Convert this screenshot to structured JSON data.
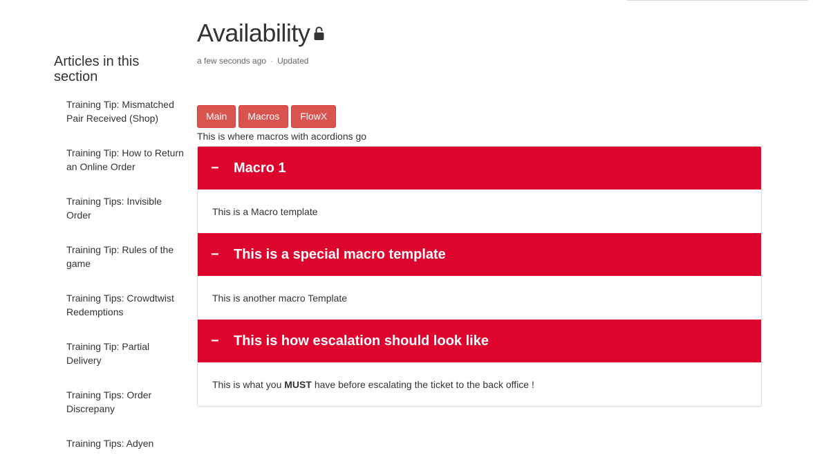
{
  "sidebar": {
    "title": "Articles in this section",
    "items": [
      {
        "label": "Training Tip: Mismatched Pair Received (Shop)"
      },
      {
        "label": "Training Tip: How to Return an Online Order"
      },
      {
        "label": "Training Tips: Invisible Order"
      },
      {
        "label": "Training Tip: Rules of the game"
      },
      {
        "label": "Training Tips: Crowdtwist Redemptions"
      },
      {
        "label": "Training Tip: Partial Delivery"
      },
      {
        "label": "Training Tips: Order Discrepany"
      },
      {
        "label": "Training Tips: Adyen"
      }
    ]
  },
  "article": {
    "title": "Availability",
    "lock_icon": "lock-icon",
    "meta_time": "a few seconds ago",
    "meta_separator": "·",
    "meta_status": "Updated"
  },
  "tabs": [
    {
      "label": "Main"
    },
    {
      "label": "Macros"
    },
    {
      "label": "FlowX"
    }
  ],
  "intro_text": "This is where macros with acordions go",
  "accordion": [
    {
      "toggle": "−",
      "title": "Macro 1",
      "body": "This is a Macro template"
    },
    {
      "toggle": "−",
      "title": "This is a special macro template",
      "body": "This is another macro Template"
    },
    {
      "toggle": "−",
      "title": "This is how escalation should look like",
      "body_before": "This is what you ",
      "body_strong": "MUST",
      "body_after": " have before escalating the ticket to the back office !"
    }
  ],
  "colors": {
    "accordion_header": "#dd042d",
    "button": "#d9534f"
  }
}
